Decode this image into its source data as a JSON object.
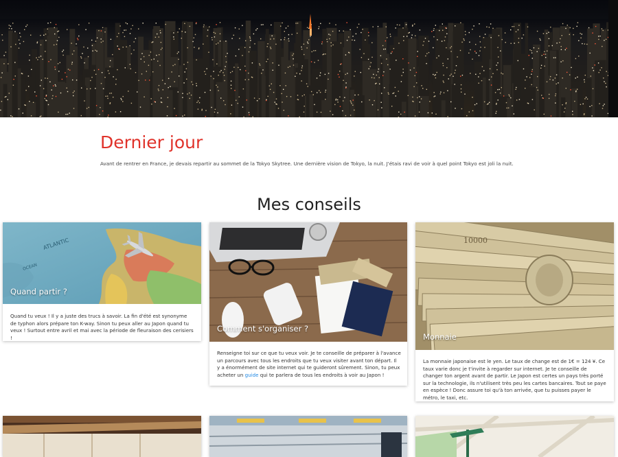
{
  "hero": {
    "image": "Tokyo skyline at night"
  },
  "intro": {
    "title": "Dernier jour",
    "text": "Avant de rentrer en France, je devais repartir au sommet de la Tokyo Skytree. Une dernière vision de Tokyo, la nuit. J'étais ravi de voir à quel point Tokyo est joli la nuit."
  },
  "section": {
    "title": "Mes conseils"
  },
  "cards": [
    {
      "caption": "Quand partir ?",
      "text": "Quand tu veux ! Il y a juste des trucs à savoir. La fin d'été est synonyme de typhon alors prépare ton K-way. Sinon tu peux aller au Japon quand tu veux ! Surtout entre avril et mai avec la période de fleuraison des cerisiers !"
    },
    {
      "caption": "Comment s'organiser ?",
      "text_before": "Renseigne toi sur ce que tu veux voir. Je te conseille de préparer à l'avance un parcours avec tous les endroits que tu veux visiter avant ton départ. Il y a énormément de site internet qui te guideront sûrement. Sinon, tu peux acheter un ",
      "link": "guide",
      "text_after": " qui te parlera de tous les endroits à voir au Japon !"
    },
    {
      "caption": "Monnaie",
      "text": "La monnaie japonaise est le yen. Le taux de change est de 1€ = 124 ¥. Ce taux varie donc je t'invite à regarder sur internet. Je te conseille de changer ton argent avant de partir. Le Japon est certes un pays très porté sur la technologie, ils n'utilisent très peu les cartes bancaires. Tout se paye en espèce ! Donc assure toi qu'à ton arrivée, que tu puisses payer le métro, le taxi, etc."
    }
  ],
  "bottom_cards": [
    {
      "image": "Japanese ryokan room"
    },
    {
      "image": "Tokyo metro train interior"
    },
    {
      "image": "Map with signpost"
    }
  ],
  "colors": {
    "title_red": "#e0322a",
    "link_blue": "#1e88e5"
  }
}
